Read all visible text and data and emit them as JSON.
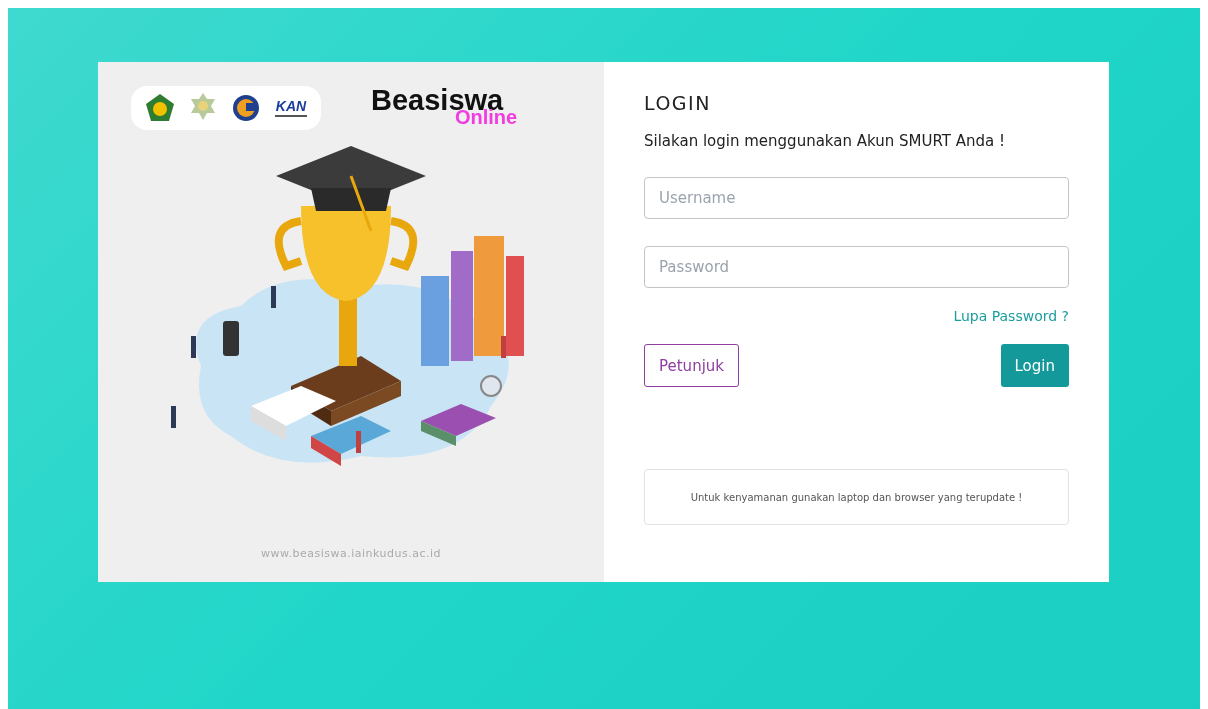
{
  "brand": {
    "title": "Beasiswa",
    "subtitle": "Online",
    "kan_logo": "KAN"
  },
  "website": "www.beasiswa.iainkudus.ac.id",
  "login": {
    "title": "LOGIN",
    "instruction": "Silakan login menggunakan Akun SMURT Anda !",
    "fields": [
      {
        "placeholder": "Username"
      },
      {
        "placeholder": "Password"
      }
    ],
    "forgot_link": "Lupa Password ?",
    "buttons": [
      {
        "kind": "outline",
        "label": "Petunjuk"
      },
      {
        "kind": "primary",
        "label": "Login"
      }
    ],
    "notice": "Untuk kenyamanan gunakan laptop dan browser yang terupdate !"
  }
}
